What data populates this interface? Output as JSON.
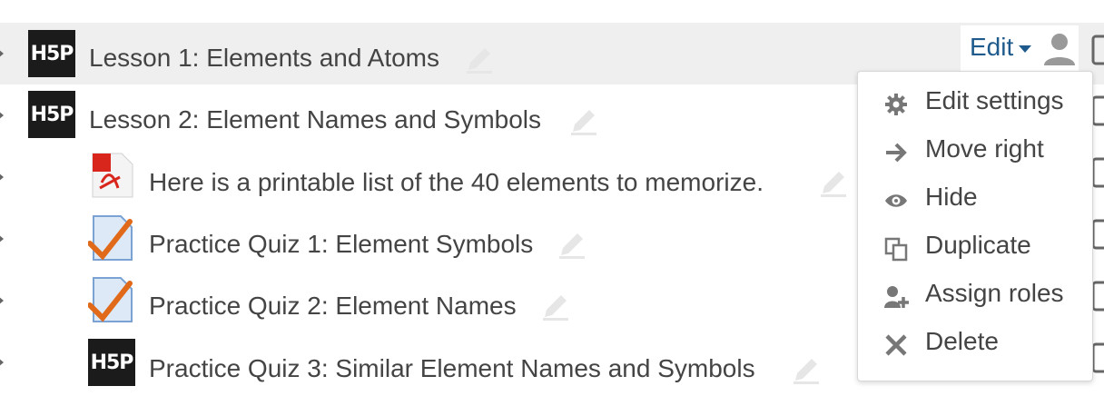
{
  "activities": [
    {
      "title": "Lesson 1: Elements and Atoms",
      "icon": "h5p-icon",
      "icon_text": "H5P"
    },
    {
      "title": "Lesson 2: Element Names and Symbols",
      "icon": "h5p-icon",
      "icon_text": "H5P"
    },
    {
      "title": "Here is a printable list of the 40 elements to memorize.",
      "icon": "pdf-file-icon"
    },
    {
      "title": "Practice Quiz 1: Element Symbols",
      "icon": "quiz-icon"
    },
    {
      "title": "Practice Quiz 2: Element Names",
      "icon": "quiz-icon"
    },
    {
      "title": "Practice Quiz 3: Similar Element Names and Symbols",
      "icon": "h5p-icon",
      "icon_text": "H5P"
    }
  ],
  "edit_menu": {
    "trigger_label": "Edit",
    "items": [
      {
        "label": "Edit settings",
        "icon": "gear-icon"
      },
      {
        "label": "Move right",
        "icon": "arrow-right-icon"
      },
      {
        "label": "Hide",
        "icon": "eye-icon"
      },
      {
        "label": "Duplicate",
        "icon": "duplicate-icon"
      },
      {
        "label": "Assign roles",
        "icon": "assign-role-icon"
      },
      {
        "label": "Delete",
        "icon": "delete-icon"
      }
    ]
  },
  "colors": {
    "link": "#1e5b8c",
    "highlight_row": "#efefef",
    "text": "#444444",
    "h5p_bg": "#1b1b1b"
  }
}
